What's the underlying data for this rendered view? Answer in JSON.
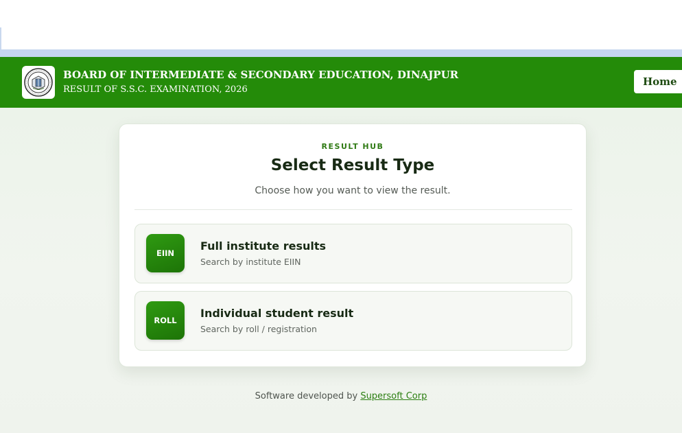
{
  "header": {
    "board_title": "BOARD OF INTERMEDIATE & SECONDARY EDUCATION, DINAJPUR",
    "result_subtitle": "RESULT OF S.S.C. EXAMINATION, 2026",
    "home_label": "Home",
    "logo_icon": "board-seal-icon"
  },
  "card": {
    "eyebrow": "RESULT HUB",
    "title": "Select Result Type",
    "description": "Choose how you want to view the result.",
    "options": [
      {
        "badge": "EIIN",
        "title": "Full institute results",
        "subtitle": "Search by institute EIIN"
      },
      {
        "badge": "ROLL",
        "title": "Individual student result",
        "subtitle": "Search by roll / registration"
      }
    ]
  },
  "footer": {
    "prefix": "Software developed by",
    "link_text": "Supersoft Corp"
  },
  "colors": {
    "header_green": "#248b09",
    "badge_green": "#2f9a12",
    "accent_text": "#2f7a14",
    "page_bg": "#eff4ed"
  }
}
